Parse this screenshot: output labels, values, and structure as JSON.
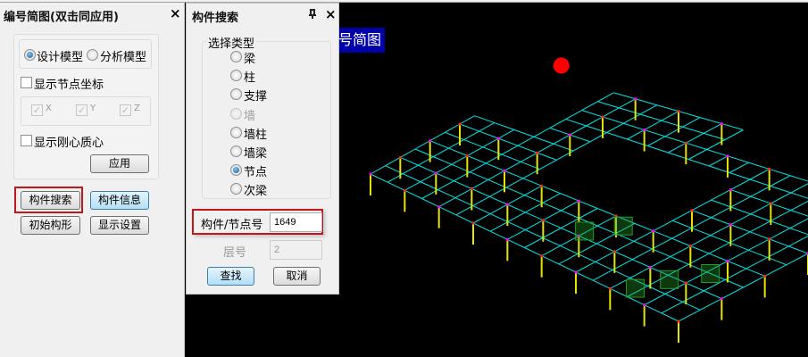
{
  "left_panel": {
    "title": "编号简图(双击同应用)",
    "close": "×",
    "model_options": [
      {
        "label": "设计模型",
        "selected": true
      },
      {
        "label": "分析模型",
        "selected": false
      }
    ],
    "show_node_coords": {
      "label": "显示节点坐标",
      "checked": false
    },
    "axes": [
      {
        "label": "X",
        "checked": true
      },
      {
        "label": "Y",
        "checked": true
      },
      {
        "label": "Z",
        "checked": true
      }
    ],
    "show_rigidity_center": {
      "label": "显示刚心质心",
      "checked": false
    },
    "apply": "应用",
    "buttons": {
      "search": "构件搜索",
      "info": "构件信息",
      "initial": "初始构形",
      "display": "显示设置"
    }
  },
  "search_panel": {
    "title": "构件搜索",
    "pin": "ᵽ",
    "close": "×",
    "group_label": "选择类型",
    "types": [
      {
        "label": "梁",
        "selected": false,
        "enabled": true
      },
      {
        "label": "柱",
        "selected": false,
        "enabled": true
      },
      {
        "label": "支撑",
        "selected": false,
        "enabled": true
      },
      {
        "label": "墙",
        "selected": false,
        "enabled": false
      },
      {
        "label": "墙柱",
        "selected": false,
        "enabled": true
      },
      {
        "label": "墙梁",
        "selected": false,
        "enabled": true
      },
      {
        "label": "节点",
        "selected": true,
        "enabled": true
      },
      {
        "label": "次梁",
        "selected": false,
        "enabled": true
      }
    ],
    "id_label": "构件/节点号",
    "id_value": "1649",
    "floor_label": "层号",
    "floor_value": "2",
    "find": "查找",
    "cancel": "取消"
  },
  "viewport": {
    "label": "号简图",
    "colors": {
      "beam": "#00e5e5",
      "column": "#e6e600",
      "node": "#ff2020",
      "highlight": "#ff0000",
      "wall": "#2a9a2a",
      "label_bg": "#0000a8"
    }
  }
}
